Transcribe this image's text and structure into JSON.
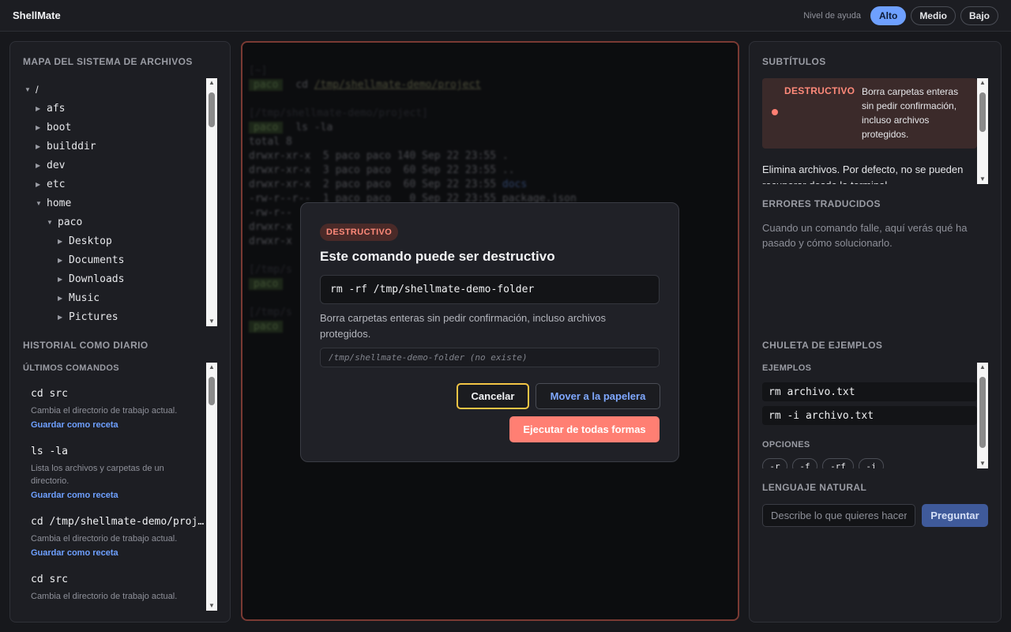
{
  "app": {
    "title": "ShellMate"
  },
  "help_level": {
    "label": "Nivel de ayuda",
    "options": [
      "Alto",
      "Medio",
      "Bajo"
    ],
    "selected": "Alto",
    "accent_color": "#6ea0ff"
  },
  "left": {
    "filesystem": {
      "title": "MAPA DEL SISTEMA DE ARCHIVOS",
      "items": [
        {
          "name": "/",
          "state": "expanded"
        },
        {
          "name": "afs",
          "state": "collapsed"
        },
        {
          "name": "boot",
          "state": "collapsed"
        },
        {
          "name": "builddir",
          "state": "collapsed"
        },
        {
          "name": "dev",
          "state": "collapsed"
        },
        {
          "name": "etc",
          "state": "collapsed"
        },
        {
          "name": "home",
          "state": "expanded"
        },
        {
          "name": "paco",
          "state": "expanded"
        },
        {
          "name": "Desktop",
          "state": "collapsed"
        },
        {
          "name": "Documents",
          "state": "collapsed"
        },
        {
          "name": "Downloads",
          "state": "collapsed"
        },
        {
          "name": "Music",
          "state": "collapsed"
        },
        {
          "name": "Pictures",
          "state": "collapsed"
        }
      ]
    },
    "history": {
      "title": "HISTORIAL COMO DIARIO",
      "subtitle": "ÚLTIMOS COMANDOS",
      "link_label": "Guardar como receta",
      "items": [
        {
          "cmd": "cd src",
          "desc": "Cambia el directorio de trabajo actual."
        },
        {
          "cmd": "ls -la",
          "desc": "Lista los archivos y carpetas de un directorio."
        },
        {
          "cmd": "cd /tmp/shellmate-demo/proje…",
          "desc": "Cambia el directorio de trabajo actual."
        },
        {
          "cmd": "cd src",
          "desc": "Cambia el directorio de trabajo actual."
        }
      ]
    }
  },
  "terminal": {
    "lines": [
      {
        "prompt": "",
        "text": "[~]",
        "dim": true
      },
      {
        "prompt": "paco",
        "text": "cd ",
        "dir": "/tmp/shellmate-demo/project"
      },
      {
        "prompt": "",
        "text": "",
        "dim": true
      },
      {
        "prompt": "",
        "text": "[/tmp/shellmate-demo/project]",
        "dim": true
      },
      {
        "prompt": "paco",
        "text": "ls -la"
      },
      {
        "prompt": "",
        "text": "total 8"
      },
      {
        "prompt": "",
        "text": "drwxr-xr-x  5 paco paco 140 Sep 22 23:55 ."
      },
      {
        "prompt": "",
        "text": "drwxr-xr-x  3 paco paco  60 Sep 22 23:55 .."
      },
      {
        "prompt": "",
        "text": "drwxr-xr-x  2 paco paco  60 Sep 22 23:55 ",
        "blue": "docs"
      },
      {
        "prompt": "",
        "text": "-rw-r--r--  1 paco paco   0 Sep 22 23:55 package.json"
      },
      {
        "prompt": "",
        "text": "-rw-r--"
      },
      {
        "prompt": "",
        "text": "drwxr-x"
      },
      {
        "prompt": "",
        "text": "drwxr-x"
      },
      {
        "prompt": "",
        "text": "",
        "dim": true
      },
      {
        "prompt": "",
        "text": "[/tmp/s",
        "dim": true
      },
      {
        "prompt": "paco",
        "text": ""
      },
      {
        "prompt": "",
        "text": "",
        "dim": true
      },
      {
        "prompt": "",
        "text": "[/tmp/s",
        "dim": true
      },
      {
        "prompt": "paco",
        "text": ""
      }
    ]
  },
  "modal": {
    "badge": "DESTRUCTIVO",
    "title": "Este comando puede ser destructivo",
    "command": "rm -rf /tmp/shellmate-demo-folder",
    "description": "Borra carpetas enteras sin pedir confirmación, incluso archivos protegidos.",
    "path_note": "/tmp/shellmate-demo-folder (no existe)",
    "cancel_label": "Cancelar",
    "trash_label": "Mover a la papelera",
    "execute_label": "Ejecutar de todas formas",
    "danger_color": "#ff7f73"
  },
  "right": {
    "subtitles": {
      "title": "SUBTÍTULOS",
      "tag": "DESTRUCTIVO",
      "text": "Borra carpetas enteras sin pedir confirmación, incluso archivos protegidos.",
      "more": "Elimina archivos. Por defecto, no se pueden recuperar desde la terminal."
    },
    "errors": {
      "title": "ERRORES TRADUCIDOS",
      "text": "Cuando un comando falle, aquí verás qué ha pasado y cómo solucionarlo."
    },
    "cheatsheet": {
      "title": "CHULETA DE EJEMPLOS",
      "examples_label": "EJEMPLOS",
      "examples": [
        "rm archivo.txt",
        "rm -i archivo.txt"
      ],
      "options_label": "OPCIONES",
      "options": [
        "-r",
        "-f",
        "-rf",
        "-i"
      ]
    },
    "natural_language": {
      "title": "LENGUAJE NATURAL",
      "placeholder": "Describe lo que quieres hacer",
      "ask_label": "Preguntar"
    }
  }
}
